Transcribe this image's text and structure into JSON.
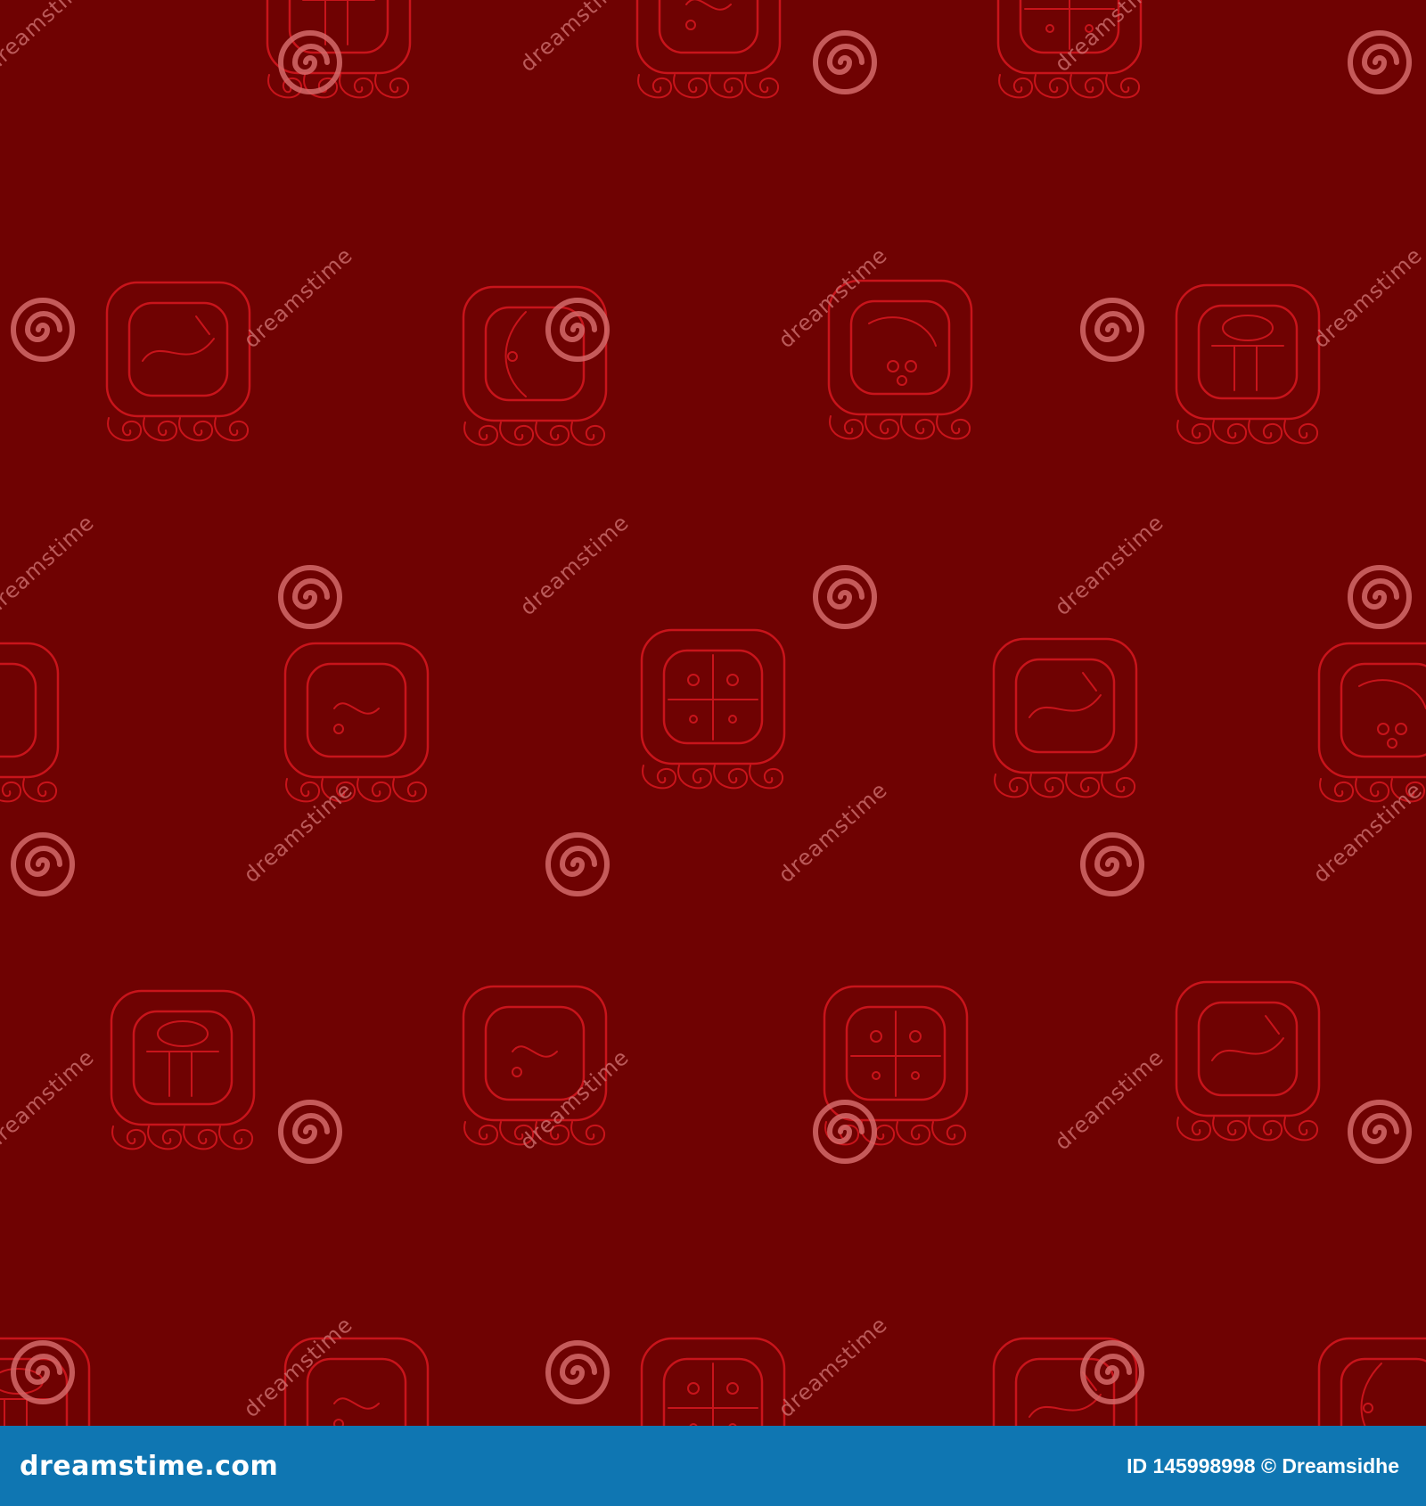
{
  "colors": {
    "background": "#6f0202",
    "glyph_stroke": "#c8141b",
    "watermark": "#cf7070",
    "footer_bar": "#0f76b2",
    "footer_text": "#ffffff"
  },
  "pattern": {
    "subject": "maya day glyphs",
    "watermark_text": "dreamstime"
  },
  "footer": {
    "site": "dreamstime.com",
    "credit": "ID 145998998 © Dreamsidhe"
  }
}
